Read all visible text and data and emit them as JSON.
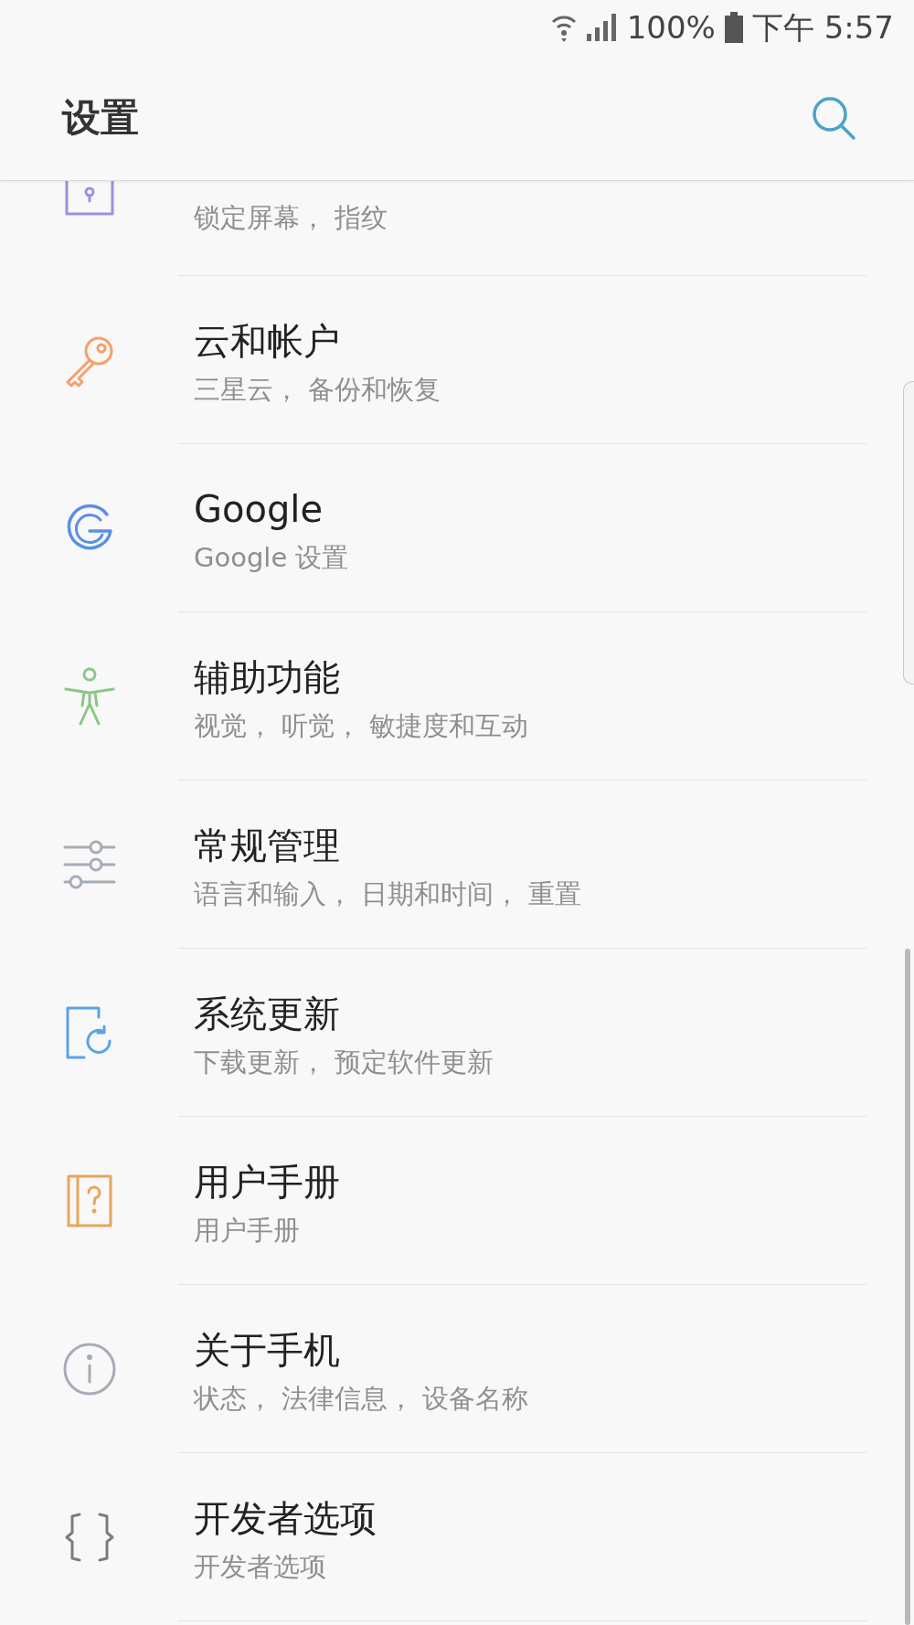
{
  "status_bar": {
    "battery": "100%",
    "time": "下午 5:57"
  },
  "header": {
    "title": "设置"
  },
  "items": [
    {
      "kind": "partial",
      "subtitle": "锁定屏幕， 指纹",
      "color": "#9d8fe0"
    },
    {
      "kind": "full",
      "title": "云和帐户",
      "subtitle": "三星云， 备份和恢复",
      "color": "#f5a06a"
    },
    {
      "kind": "full",
      "title": "Google",
      "subtitle": "Google 设置",
      "color": "#5a8fe6"
    },
    {
      "kind": "full",
      "title": "辅助功能",
      "subtitle": "视觉， 听觉， 敏捷度和互动",
      "color": "#8cc68a"
    },
    {
      "kind": "full",
      "title": "常规管理",
      "subtitle": "语言和输入， 日期和时间， 重置",
      "color": "#a6adb5"
    },
    {
      "kind": "full",
      "title": "系统更新",
      "subtitle": "下载更新， 预定软件更新",
      "color": "#5aa3e8"
    },
    {
      "kind": "full",
      "title": "用户手册",
      "subtitle": "用户手册",
      "color": "#e8a55a"
    },
    {
      "kind": "full",
      "title": "关于手机",
      "subtitle": "状态， 法律信息， 设备名称",
      "color": "#a6adb5"
    },
    {
      "kind": "full",
      "title": "开发者选项",
      "subtitle": "开发者选项",
      "color": "#7d7d7d"
    }
  ]
}
